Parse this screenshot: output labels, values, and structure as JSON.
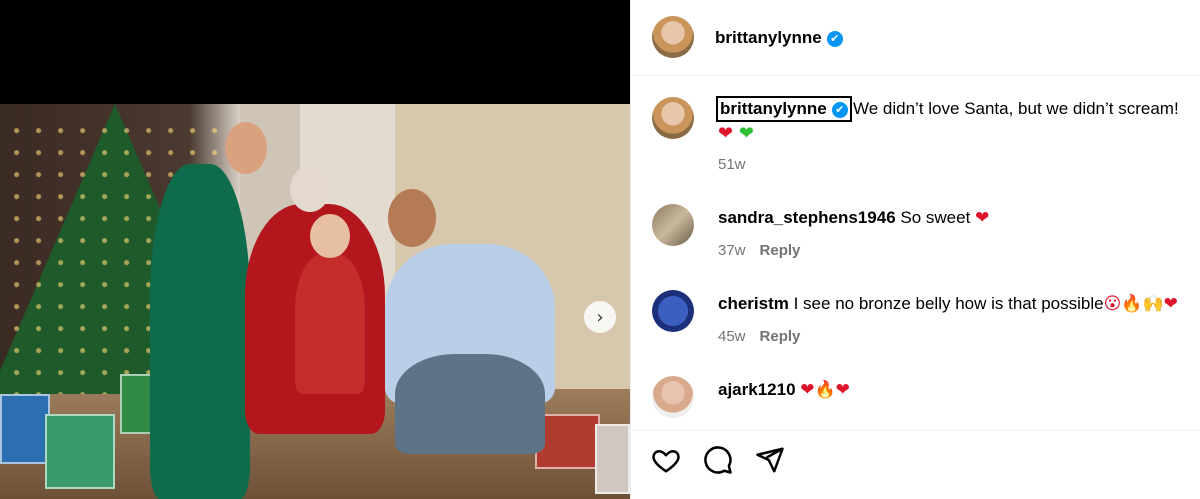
{
  "media": {
    "next_icon": "chevron-right-icon"
  },
  "post": {
    "author": "brittanylynne",
    "verified_mark": "✔",
    "caption_user": "brittanylynne",
    "caption_text": "We didn’t love Santa, but we didn’t scream!",
    "caption_emojis": [
      "❤",
      "❤"
    ],
    "caption_age": "51w"
  },
  "comments": [
    {
      "user": "sandra_stephens1946",
      "text": "So sweet",
      "emoji": "❤",
      "age": "37w",
      "reply_label": "Reply"
    },
    {
      "user": "cheristm",
      "text": "I see no bronze belly how is that possible",
      "emoji": "😮🔥🙌❤",
      "age": "45w",
      "reply_label": "Reply"
    },
    {
      "user": "ajark1210",
      "text": "",
      "emoji": "❤🔥❤",
      "age": "",
      "reply_label": ""
    }
  ],
  "actions": {
    "like_icon": "heart-outline-icon",
    "comment_icon": "speech-bubble-icon",
    "share_icon": "paper-plane-icon"
  },
  "colors": {
    "verified": "#0095f6",
    "meta_gray": "#737373",
    "heart_red": "#e0142a",
    "heart_green": "#2fbf36"
  }
}
